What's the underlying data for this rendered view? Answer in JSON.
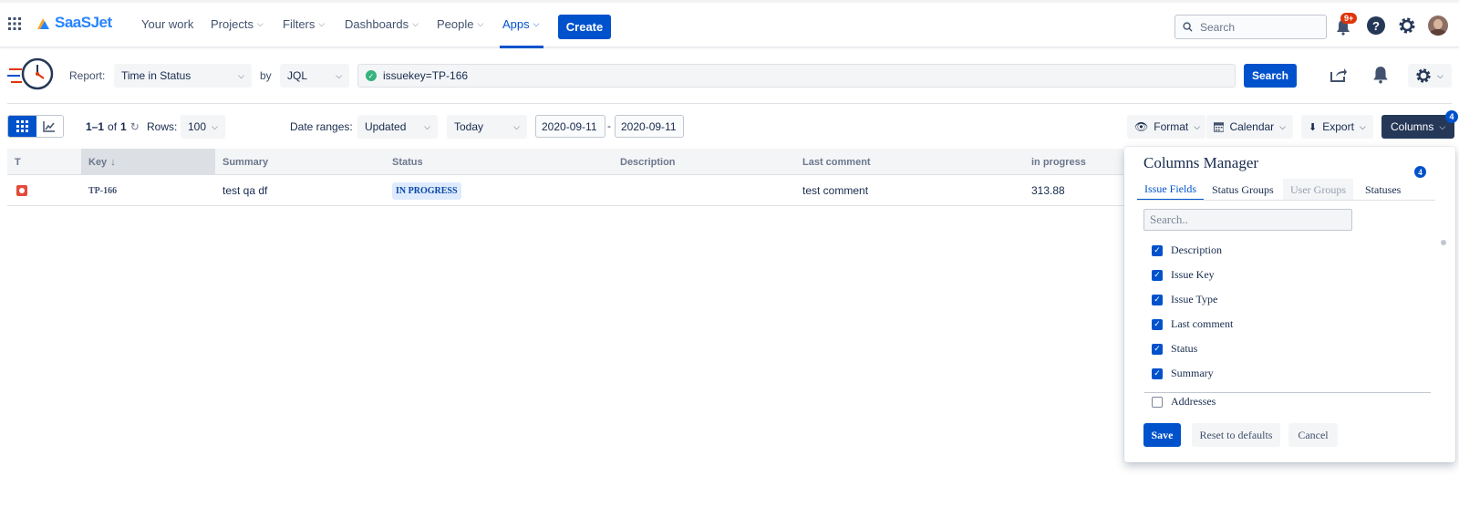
{
  "nav": {
    "brand": "SaaSJet",
    "items": [
      {
        "label": "Your work",
        "dropdown": false
      },
      {
        "label": "Projects",
        "dropdown": true
      },
      {
        "label": "Filters",
        "dropdown": true
      },
      {
        "label": "Dashboards",
        "dropdown": true
      },
      {
        "label": "People",
        "dropdown": true
      },
      {
        "label": "Apps",
        "dropdown": true
      }
    ],
    "create_label": "Create",
    "search_placeholder": "Search",
    "notifications_badge": "9+"
  },
  "report_bar": {
    "report_label": "Report:",
    "report_value": "Time in Status",
    "by_label": "by",
    "by_value": "JQL",
    "jql_value": "issuekey=TP-166",
    "search_button": "Search"
  },
  "toolbar": {
    "pagination": "1–1",
    "pagination_of": "of",
    "pagination_total": "1",
    "rows_label": "Rows:",
    "rows_value": "100",
    "date_ranges_label": "Date ranges:",
    "date_field": "Updated",
    "date_preset": "Today",
    "date_from": "2020-09-11",
    "date_separator": "-",
    "date_to": "2020-09-11",
    "format_label": "Format",
    "calendar_label": "Calendar",
    "export_label": "Export",
    "columns_label": "Columns",
    "columns_badge": "4"
  },
  "table": {
    "headers": [
      "T",
      "Key",
      "Summary",
      "Status",
      "Description",
      "Last comment",
      "in progress"
    ],
    "rows": [
      {
        "key": "TP-166",
        "summary": "test qa df",
        "status": "IN PROGRESS",
        "description": "",
        "last_comment": "test comment",
        "in_progress": "313.88"
      }
    ]
  },
  "columns_manager": {
    "title": "Columns Manager",
    "tabs": [
      "Issue Fields",
      "Status Groups",
      "User Groups",
      "Statuses"
    ],
    "tab_badge": "4",
    "search_placeholder": "Search..",
    "checked_fields": [
      "Description",
      "Issue Key",
      "Issue Type",
      "Last comment",
      "Status",
      "Summary"
    ],
    "unchecked_fields": [
      "Addresses"
    ],
    "save_label": "Save",
    "reset_label": "Reset to defaults",
    "cancel_label": "Cancel"
  },
  "colors": {
    "primary": "#0052cc",
    "status_bg": "#deebff",
    "bug": "#e5493a",
    "success": "#36b37e"
  }
}
